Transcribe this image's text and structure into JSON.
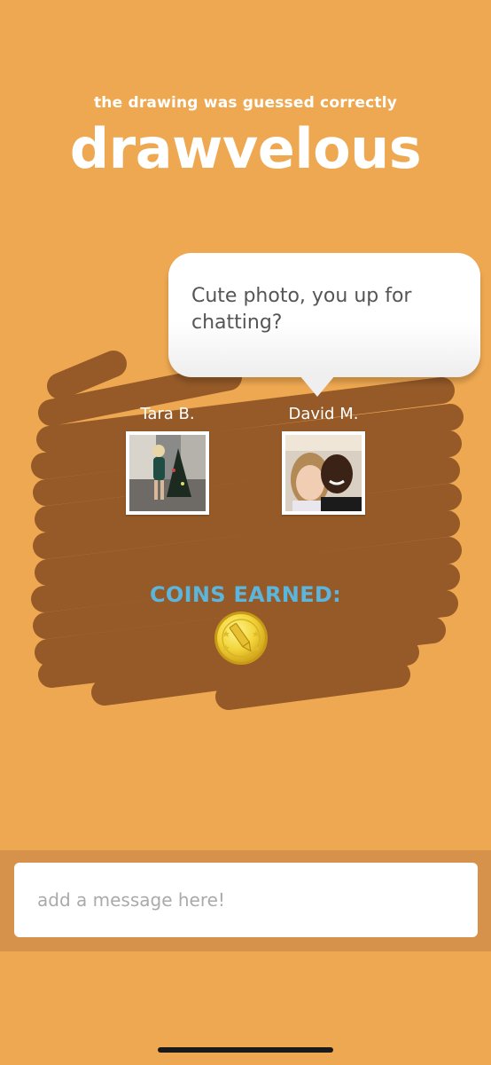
{
  "result": {
    "subtitle": "the drawing was guessed correctly",
    "headline": "drawvelous"
  },
  "chat_bubble": {
    "message": "Cute photo, you up for chatting?"
  },
  "players": [
    {
      "name": "Tara B.",
      "photo": "avatar-photo"
    },
    {
      "name": "David M.",
      "photo": "avatar-photo"
    }
  ],
  "coins": {
    "label": "COINS EARNED:",
    "icon": "pencil-coin-icon"
  },
  "composer": {
    "placeholder": "add a message here!"
  },
  "colors": {
    "background": "#EEA851",
    "scribble": "#955A28",
    "coins_label": "#5BB5DD",
    "bottom_bar": "#D6914A",
    "coin_gold": "#F2D53A"
  }
}
